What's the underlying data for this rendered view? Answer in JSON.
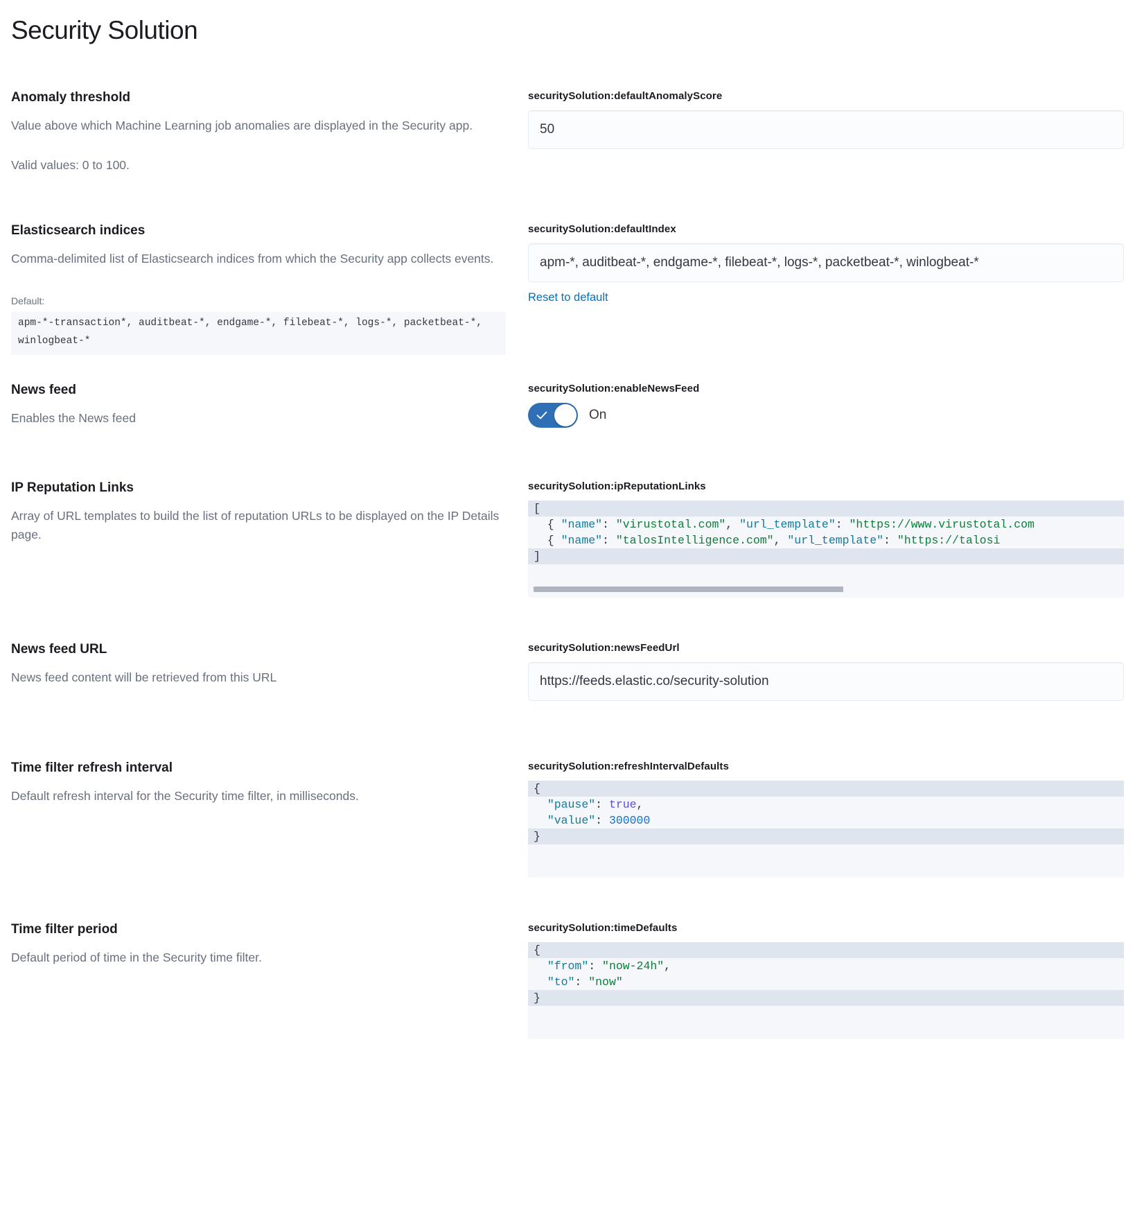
{
  "page": {
    "title": "Security Solution"
  },
  "colors": {
    "accent_link": "#0071c2",
    "toggle_on": "#2f6fb5",
    "code_bg": "#f5f7fa",
    "code_active_line": "#dfe5ef",
    "json_key": "#127b9c",
    "json_string": "#0f7d3b",
    "json_number": "#1a6fc4",
    "json_boolean": "#5b4ddb"
  },
  "settings": [
    {
      "title": "Anomaly threshold",
      "description": "Value above which Machine Learning job anomalies are displayed in the Security app.",
      "description2": "Valid values: 0 to 100.",
      "field_label": "securitySolution:defaultAnomalyScore",
      "value": "50",
      "control": "text"
    },
    {
      "title": "Elasticsearch indices",
      "description": "Comma-delimited list of Elasticsearch indices from which the Security app collects events.",
      "default_label": "Default:",
      "default_value": "apm-*-transaction*, auditbeat-*, endgame-*, filebeat-*, logs-*, packetbeat-*, winlogbeat-*",
      "field_label": "securitySolution:defaultIndex",
      "value": "apm-*, auditbeat-*, endgame-*, filebeat-*, logs-*, packetbeat-*, winlogbeat-*",
      "reset_label": "Reset to default",
      "control": "text"
    },
    {
      "title": "News feed",
      "description": "Enables the News feed",
      "field_label": "securitySolution:enableNewsFeed",
      "toggle_state_label": "On",
      "toggle_on": true,
      "control": "toggle"
    },
    {
      "title": "IP Reputation Links",
      "description": "Array of URL templates to build the list of reputation URLs to be displayed on the IP Details page.",
      "field_label": "securitySolution:ipReputationLinks",
      "control": "code",
      "code_lines": [
        {
          "active": true,
          "tokens": [
            {
              "t": "[",
              "c": "punct"
            }
          ]
        },
        {
          "active": false,
          "tokens": [
            {
              "t": "  { ",
              "c": "punct"
            },
            {
              "t": "\"name\"",
              "c": "key"
            },
            {
              "t": ": ",
              "c": "punct"
            },
            {
              "t": "\"virustotal.com\"",
              "c": "str"
            },
            {
              "t": ", ",
              "c": "punct"
            },
            {
              "t": "\"url_template\"",
              "c": "key"
            },
            {
              "t": ": ",
              "c": "punct"
            },
            {
              "t": "\"https://www.virustotal.com",
              "c": "str"
            }
          ]
        },
        {
          "active": false,
          "tokens": [
            {
              "t": "  { ",
              "c": "punct"
            },
            {
              "t": "\"name\"",
              "c": "key"
            },
            {
              "t": ": ",
              "c": "punct"
            },
            {
              "t": "\"talosIntelligence.com\"",
              "c": "str"
            },
            {
              "t": ", ",
              "c": "punct"
            },
            {
              "t": "\"url_template\"",
              "c": "key"
            },
            {
              "t": ": ",
              "c": "punct"
            },
            {
              "t": "\"https://talosi",
              "c": "str"
            }
          ]
        },
        {
          "active": true,
          "tokens": [
            {
              "t": "]",
              "c": "punct"
            }
          ]
        }
      ],
      "editor_height": 140,
      "has_scrollbar": true,
      "scrollbar_width_pct": 52
    },
    {
      "title": "News feed URL",
      "description": "News feed content will be retrieved from this URL",
      "field_label": "securitySolution:newsFeedUrl",
      "value": "https://feeds.elastic.co/security-solution",
      "control": "text"
    },
    {
      "title": "Time filter refresh interval",
      "description": "Default refresh interval for the Security time filter, in milliseconds.",
      "field_label": "securitySolution:refreshIntervalDefaults",
      "control": "code",
      "code_lines": [
        {
          "active": true,
          "tokens": [
            {
              "t": "{",
              "c": "punct"
            }
          ]
        },
        {
          "active": false,
          "tokens": [
            {
              "t": "  ",
              "c": "punct"
            },
            {
              "t": "\"pause\"",
              "c": "key"
            },
            {
              "t": ": ",
              "c": "punct"
            },
            {
              "t": "true",
              "c": "bool"
            },
            {
              "t": ",",
              "c": "punct"
            }
          ]
        },
        {
          "active": false,
          "tokens": [
            {
              "t": "  ",
              "c": "punct"
            },
            {
              "t": "\"value\"",
              "c": "key"
            },
            {
              "t": ": ",
              "c": "punct"
            },
            {
              "t": "300000",
              "c": "num"
            }
          ]
        },
        {
          "active": true,
          "tokens": [
            {
              "t": "}",
              "c": "punct"
            }
          ]
        }
      ],
      "editor_height": 140,
      "has_scrollbar": false
    },
    {
      "title": "Time filter period",
      "description": "Default period of time in the Security time filter.",
      "field_label": "securitySolution:timeDefaults",
      "control": "code",
      "code_lines": [
        {
          "active": true,
          "tokens": [
            {
              "t": "{",
              "c": "punct"
            }
          ]
        },
        {
          "active": false,
          "tokens": [
            {
              "t": "  ",
              "c": "punct"
            },
            {
              "t": "\"from\"",
              "c": "key"
            },
            {
              "t": ": ",
              "c": "punct"
            },
            {
              "t": "\"now-24h\"",
              "c": "str"
            },
            {
              "t": ",",
              "c": "punct"
            }
          ]
        },
        {
          "active": false,
          "tokens": [
            {
              "t": "  ",
              "c": "punct"
            },
            {
              "t": "\"to\"",
              "c": "key"
            },
            {
              "t": ": ",
              "c": "punct"
            },
            {
              "t": "\"now\"",
              "c": "str"
            }
          ]
        },
        {
          "active": true,
          "tokens": [
            {
              "t": "}",
              "c": "punct"
            }
          ]
        }
      ],
      "editor_height": 140,
      "has_scrollbar": false
    }
  ]
}
